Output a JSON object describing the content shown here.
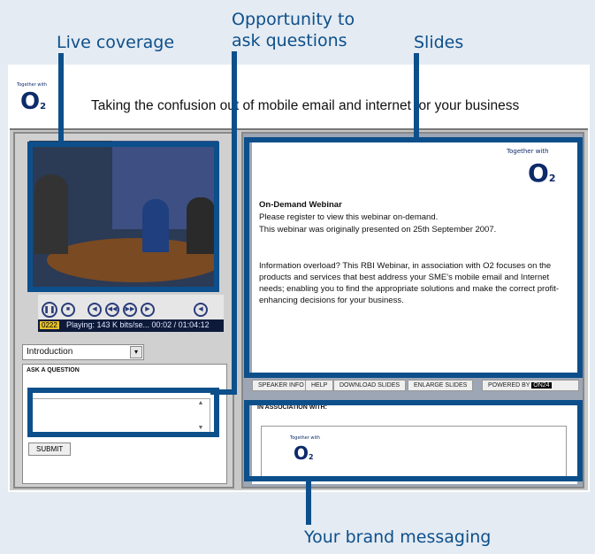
{
  "callouts": {
    "live_coverage": "Live coverage",
    "opportunity_line1": "Opportunity to",
    "opportunity_line2": "ask questions",
    "slides": "Slides",
    "brand_messaging": "Your brand messaging"
  },
  "header": {
    "logo_small": "Together with",
    "logo": "O",
    "logo_sub": "2",
    "title": "Taking the confusion out of mobile email and internet for your business"
  },
  "player": {
    "badge": "0222",
    "status": "Playing: 143 K bits/se... 00:02 / 01:04:12"
  },
  "section_select": {
    "value": "Introduction"
  },
  "question": {
    "heading": "ASK A QUESTION",
    "submit": "SUBMIT"
  },
  "slide": {
    "logo_small": "Together with",
    "logo": "O",
    "logo_sub": "2",
    "heading": "On-Demand Webinar",
    "line1": "Please register to view this webinar on-demand.",
    "line2": "This webinar was originally presented on 25th September 2007.",
    "para": "Information overload? This RBI Webinar, in association with O2 focuses on the products and services that best address your SME's mobile email and Internet needs; enabling you to find the appropriate solutions and make the correct profit-enhancing decisions for your business."
  },
  "toolbar": {
    "speaker_info": "SPEAKER INFO",
    "help": "HELP",
    "download": "DOWNLOAD SLIDES",
    "enlarge": "ENLARGE SLIDES",
    "powered": "POWERED BY",
    "powered_brand": "ON24"
  },
  "association": {
    "heading": "IN ASSOCIATION WITH:",
    "logo_small": "Together with",
    "logo": "O",
    "logo_sub": "2"
  }
}
